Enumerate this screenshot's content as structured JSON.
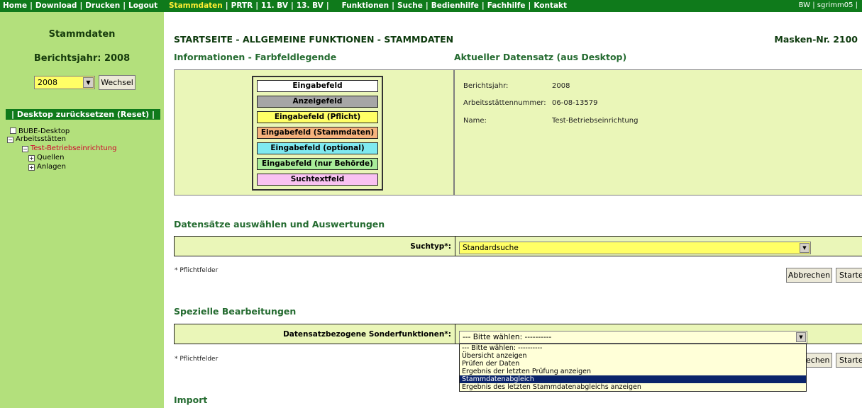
{
  "topbar": {
    "left_links": [
      "Home",
      "Download",
      "Drucken",
      "Logout"
    ],
    "mid_links": [
      "Stammdaten",
      "PRTR",
      "11. BV",
      "13. BV",
      "Funktionen",
      "Suche",
      "Bedienhilfe",
      "Fachhilfe",
      "Kontakt"
    ],
    "active": "Stammdaten",
    "user": "BW | sgrimm05 |"
  },
  "sidebar": {
    "title": "Stammdaten",
    "year_label": "Berichtsjahr: 2008",
    "year_select_value": "2008",
    "wechsel_label": "Wechsel",
    "reset_label": "| Desktop zurücksetzen (Reset) |",
    "tree": {
      "desktop": "BUBE-Desktop",
      "arbeitsstaetten": "Arbeitsstätten",
      "betrieb": "Test-Betriebseinrichtung",
      "quellen": "Quellen",
      "anlagen": "Anlagen"
    }
  },
  "main": {
    "title": "STARTSEITE - ALLGEMEINE FUNKTIONEN - STAMMDATEN",
    "masken": "Masken-Nr. 2100",
    "info_heading": "Informationen - Farbfeldlegende",
    "ds_heading": "Aktueller Datensatz (aus Desktop)",
    "legend": [
      {
        "label": "Eingabefeld",
        "color": "#ffffff"
      },
      {
        "label": "Anzeigefeld",
        "color": "#a6a6a6"
      },
      {
        "label": "Eingabefeld (Pflicht)",
        "color": "#ffff66"
      },
      {
        "label": "Eingabefeld (Stammdaten)",
        "color": "#f5b27d"
      },
      {
        "label": "Eingabefeld (optional)",
        "color": "#7fe9f0"
      },
      {
        "label": "Eingabefeld (nur Behörde)",
        "color": "#a9ec9a"
      },
      {
        "label": "Suchtextfeld",
        "color": "#f9c2f2"
      }
    ],
    "datensatz": {
      "berichtsjahr_label": "Berichtsjahr:",
      "berichtsjahr": "2008",
      "nummer_label": "Arbeitsstättennummer:",
      "nummer": "06-08-13579",
      "name_label": "Name:",
      "name": "Test-Betriebseinrichtung"
    },
    "auswahl_heading": "Datensätze auswählen und Auswertungen",
    "suchtyp_label": "Suchtyp*:",
    "suchtyp_value": "Standardsuche",
    "pflichtfelder": "* Pflichtfelder",
    "abbrechen": "Abbrechen",
    "starten": "Starten",
    "abbrechen_partial": "echen",
    "speziell_heading": "Spezielle Bearbeitungen",
    "sonder_label": "Datensatzbezogene Sonderfunktionen*:",
    "sonder_value": "--- Bitte wählen: ----------",
    "sonder_options": [
      "--- Bitte wählen: ----------",
      "Übersicht anzeigen",
      "Prüfen der Daten",
      "Ergebnis der letzten Prüfung anzeigen",
      "Stammdatenabgleich",
      "Ergebnis des letzten Stammdatenabgleichs anzeigen"
    ],
    "sonder_selected_index": 4,
    "import_heading": "Import"
  },
  "colors": {
    "topbar": "#0f7a1b",
    "sidebar": "#b3e07c",
    "panel": "#eaf6b8",
    "heading": "#246b30",
    "active_link": "#ffee33"
  }
}
